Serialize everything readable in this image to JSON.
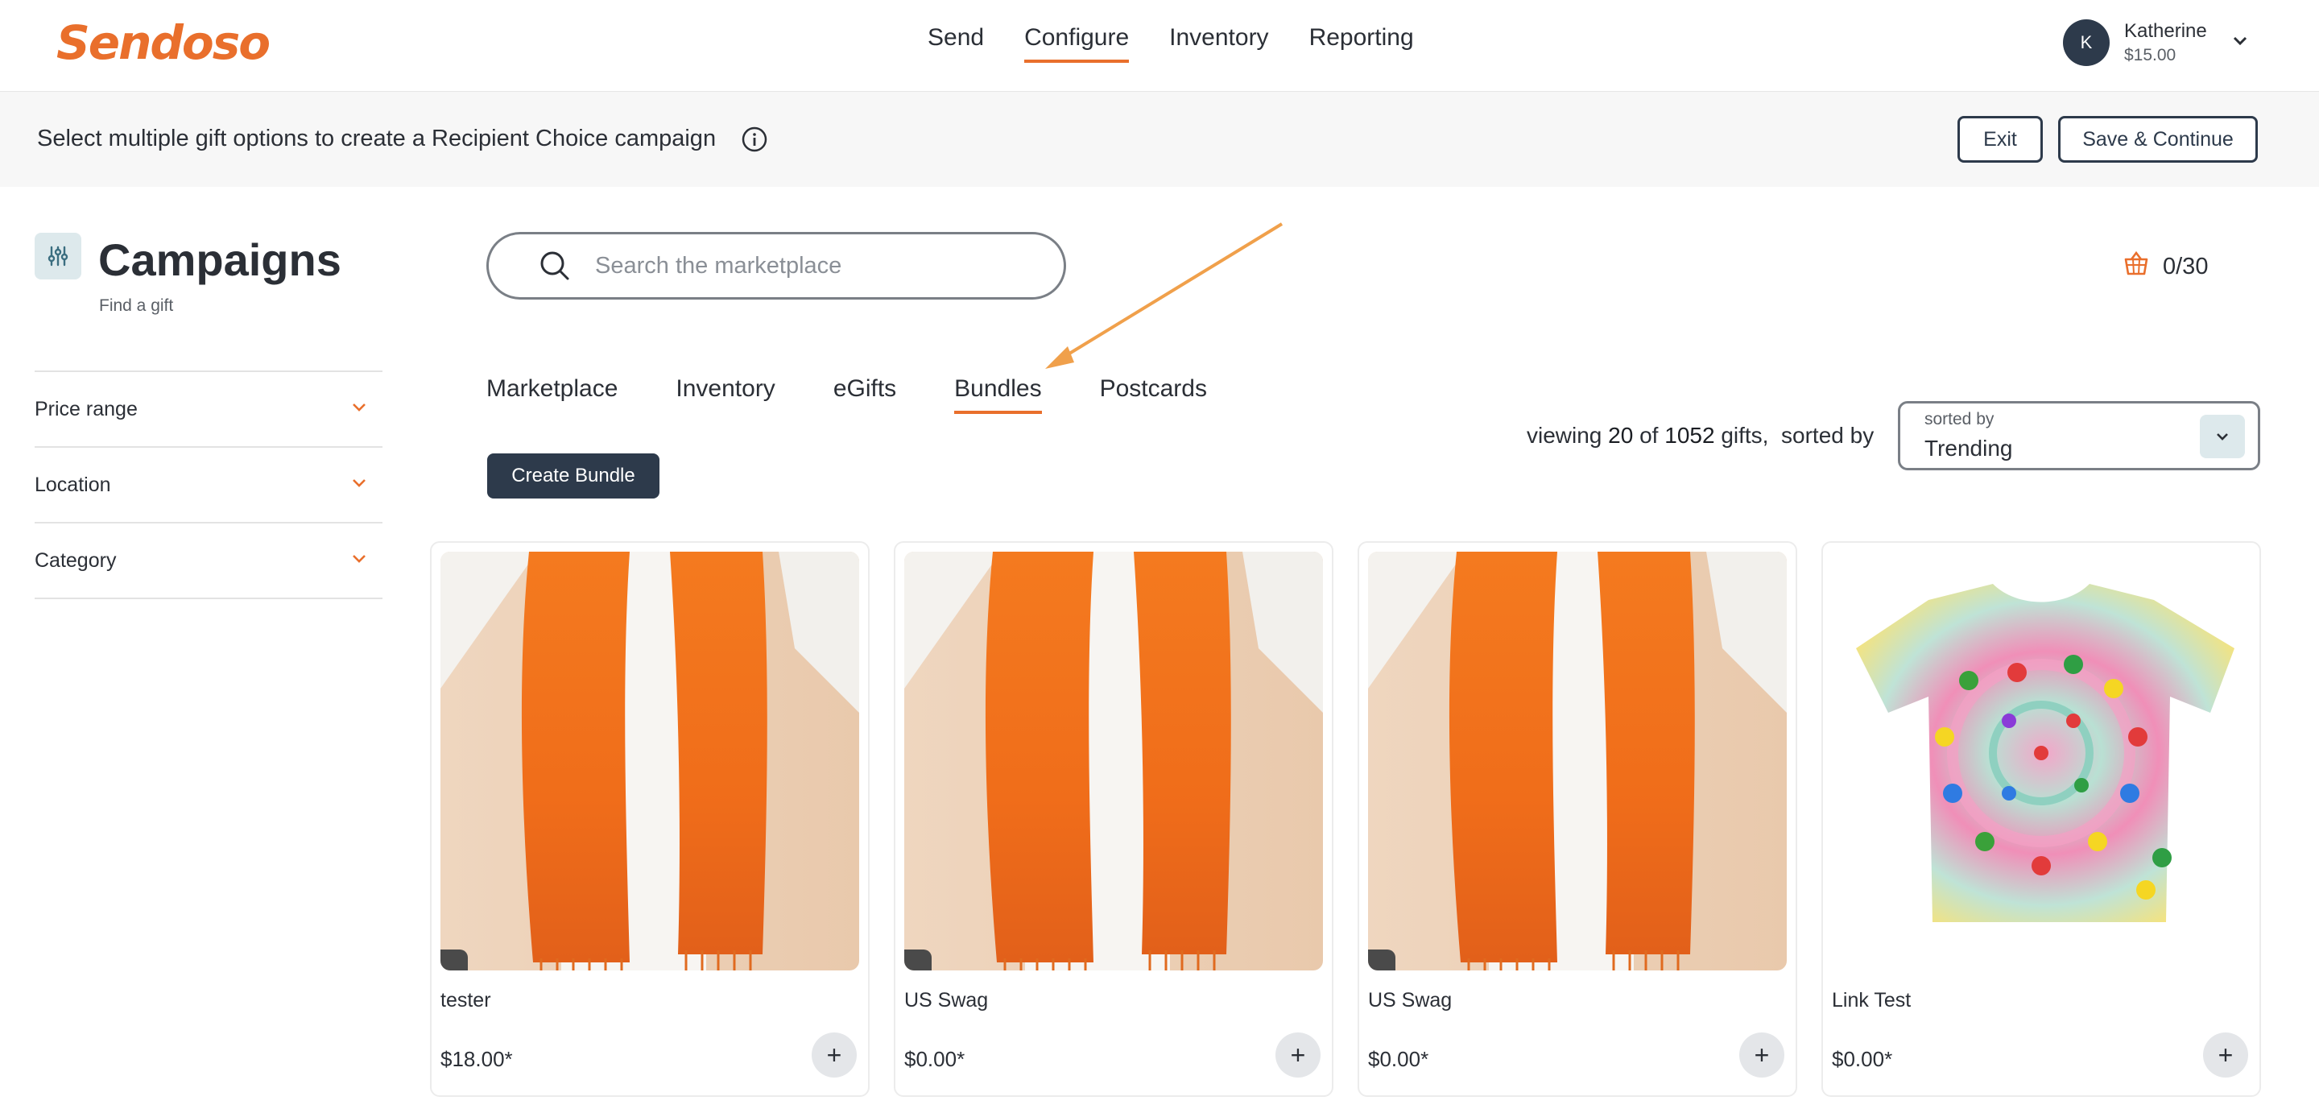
{
  "brand": {
    "logo_text": "Sendoso",
    "accent": "#e96f2c",
    "dark": "#2d3a4b"
  },
  "nav": {
    "links": [
      "Send",
      "Configure",
      "Inventory",
      "Reporting"
    ],
    "active": "Configure"
  },
  "user": {
    "initial": "K",
    "name": "Katherine",
    "balance": "$15.00"
  },
  "subbar": {
    "message": "Select multiple gift options to create a Recipient Choice campaign",
    "exit_label": "Exit",
    "save_label": "Save & Continue"
  },
  "sidebar": {
    "title": "Campaigns",
    "subtitle": "Find a gift",
    "filters": [
      "Price range",
      "Location",
      "Category"
    ]
  },
  "search": {
    "placeholder": "Search the marketplace"
  },
  "cart": {
    "count": "0/30"
  },
  "tabs": {
    "items": [
      "Marketplace",
      "Inventory",
      "eGifts",
      "Bundles",
      "Postcards"
    ],
    "active": "Bundles"
  },
  "create_bundle_label": "Create Bundle",
  "results": {
    "viewing_prefix": "viewing",
    "shown": "20",
    "of": "of",
    "total": "1052",
    "suffix": "gifts,",
    "sorted_by_text": "sorted by",
    "sort_label": "sorted by",
    "sort_value": "Trending"
  },
  "products": [
    {
      "title": "tester",
      "price": "$18.00*",
      "image": "orange-scarf",
      "add_label": "+"
    },
    {
      "title": "US Swag",
      "price": "$0.00*",
      "image": "orange-scarf",
      "add_label": "+"
    },
    {
      "title": "US Swag",
      "price": "$0.00*",
      "image": "orange-scarf",
      "add_label": "+"
    },
    {
      "title": "Link Test",
      "price": "$0.00*",
      "image": "tie-dye-tshirt",
      "add_label": "+"
    }
  ]
}
